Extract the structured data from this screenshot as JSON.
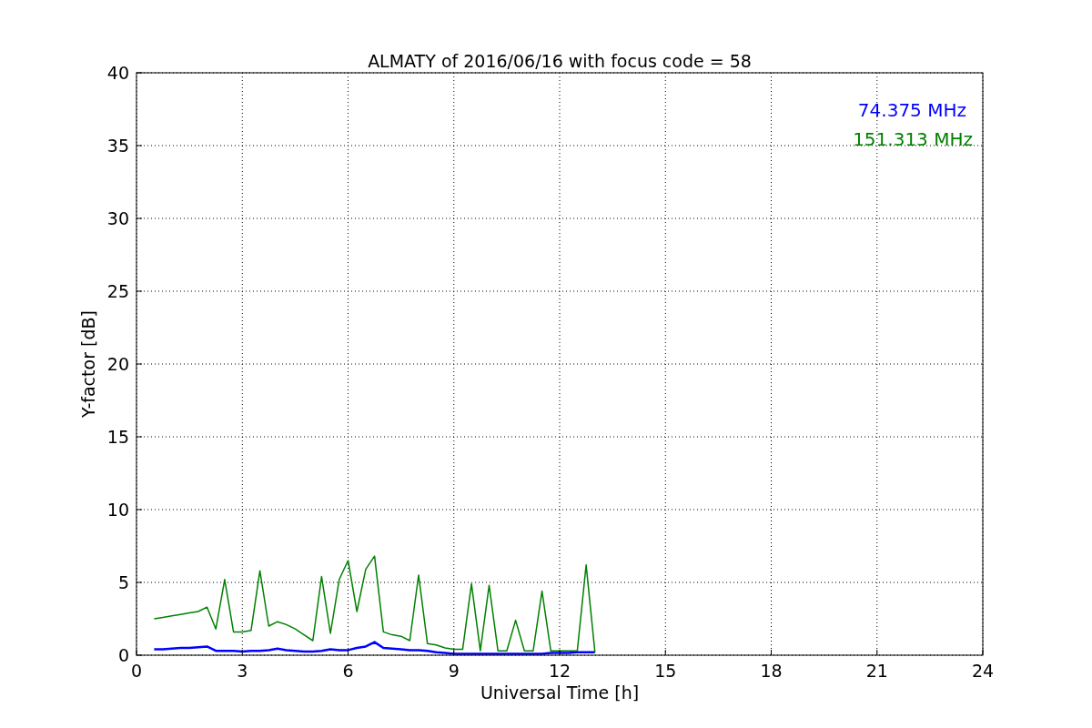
{
  "chart_data": {
    "type": "line",
    "title": "ALMATY of 2016/06/16 with focus code = 58",
    "xlabel": "Universal Time [h]",
    "ylabel": "Y-factor [dB]",
    "x": [
      0.5,
      0.75,
      1,
      1.25,
      1.5,
      1.75,
      2,
      2.25,
      2.5,
      2.75,
      3,
      3.25,
      3.5,
      3.75,
      4,
      4.25,
      4.5,
      4.75,
      5,
      5.25,
      5.5,
      5.75,
      6,
      6.25,
      6.5,
      6.75,
      7,
      7.25,
      7.5,
      7.75,
      8,
      8.25,
      8.5,
      8.75,
      9,
      9.25,
      9.5,
      9.75,
      10,
      10.25,
      10.5,
      10.75,
      11,
      11.25,
      11.5,
      11.75,
      12,
      12.25,
      12.5,
      12.75,
      13
    ],
    "series": [
      {
        "name": "74.375 MHz",
        "color": "#0000ff",
        "values": [
          0.4,
          0.4,
          0.45,
          0.5,
          0.5,
          0.55,
          0.6,
          0.3,
          0.3,
          0.3,
          0.25,
          0.3,
          0.3,
          0.35,
          0.45,
          0.35,
          0.3,
          0.25,
          0.25,
          0.3,
          0.4,
          0.35,
          0.35,
          0.5,
          0.6,
          0.9,
          0.5,
          0.45,
          0.4,
          0.35,
          0.35,
          0.3,
          0.2,
          0.15,
          0.1,
          0.1,
          0.1,
          0.1,
          0.1,
          0.1,
          0.1,
          0.1,
          0.1,
          0.1,
          0.1,
          0.15,
          0.15,
          0.15,
          0.2,
          0.2,
          0.2
        ]
      },
      {
        "name": "151.313 MHz",
        "color": "#008000",
        "values": [
          2.5,
          2.6,
          2.7,
          2.8,
          2.9,
          3.0,
          3.3,
          1.8,
          5.2,
          1.6,
          1.6,
          1.7,
          5.8,
          2.0,
          2.3,
          2.1,
          1.8,
          1.4,
          1.0,
          5.4,
          1.5,
          5.2,
          6.5,
          3.0,
          5.9,
          6.8,
          1.6,
          1.4,
          1.3,
          1.0,
          5.5,
          0.8,
          0.7,
          0.5,
          0.4,
          0.4,
          4.9,
          0.3,
          4.8,
          0.3,
          0.3,
          2.4,
          0.3,
          0.3,
          4.4,
          0.3,
          0.3,
          0.3,
          0.3,
          6.2,
          0.2
        ]
      }
    ],
    "grid": true,
    "xlim": [
      0,
      24
    ],
    "ylim": [
      0,
      40
    ],
    "xticks": [
      0,
      3,
      6,
      9,
      12,
      15,
      18,
      21,
      24
    ],
    "yticks": [
      0,
      5,
      10,
      15,
      20,
      25,
      30,
      35,
      40
    ]
  }
}
